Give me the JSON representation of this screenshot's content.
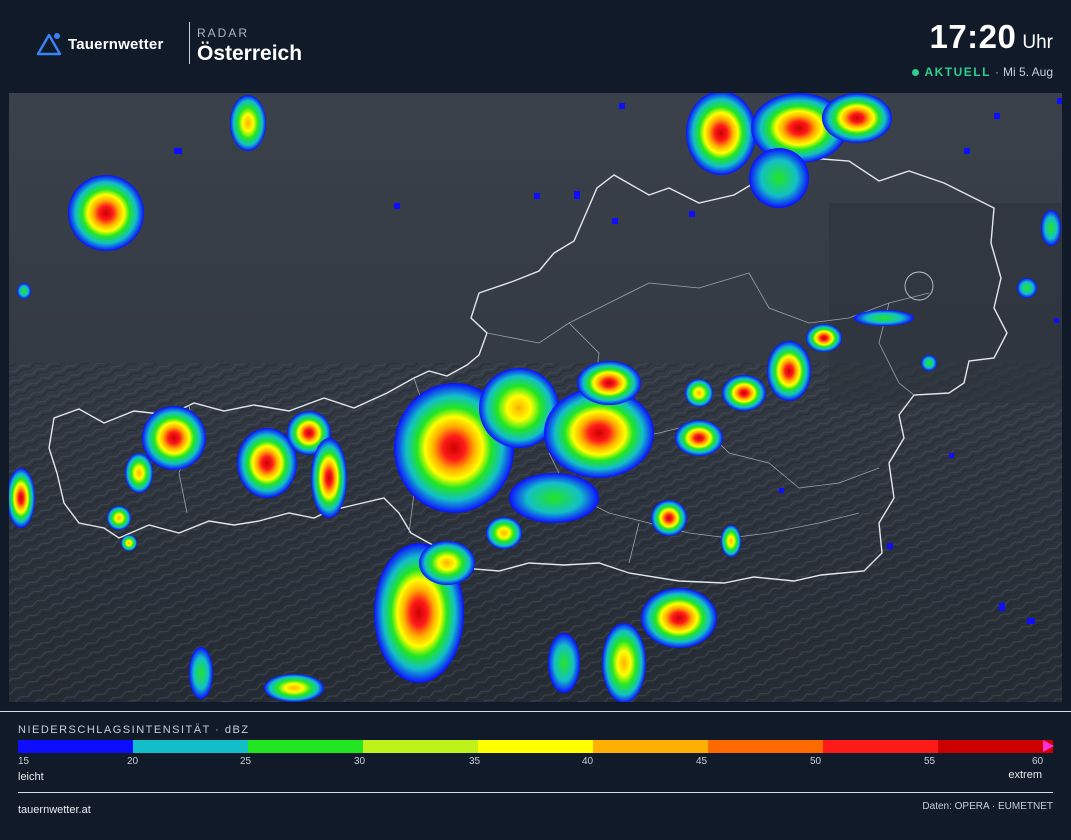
{
  "header": {
    "brand": "Tauernwetter",
    "kicker": "RADAR",
    "region": "Österreich",
    "time": "17:20",
    "time_unit": "Uhr",
    "status_label": "AKTUELL",
    "date": "Mi 5. Aug",
    "status_color": "#2ecf8e"
  },
  "legend": {
    "title": "NIEDERSCHLAGSINTENSITÄT · dBZ",
    "colors": [
      "#0d0dff",
      "#12bfc9",
      "#22e622",
      "#bff21a",
      "#ffff00",
      "#ffb000",
      "#ff6a00",
      "#ff1a1a",
      "#cc0000"
    ],
    "arrow_color": "#ff2fd6",
    "ticks": [
      "15",
      "20",
      "25",
      "30",
      "35",
      "40",
      "45",
      "50",
      "55",
      "60"
    ],
    "low_label": "leicht",
    "high_label": "extrem"
  },
  "footer": {
    "site": "tauernwetter.at",
    "credits": "Daten: OPERA · EUMETNET"
  }
}
